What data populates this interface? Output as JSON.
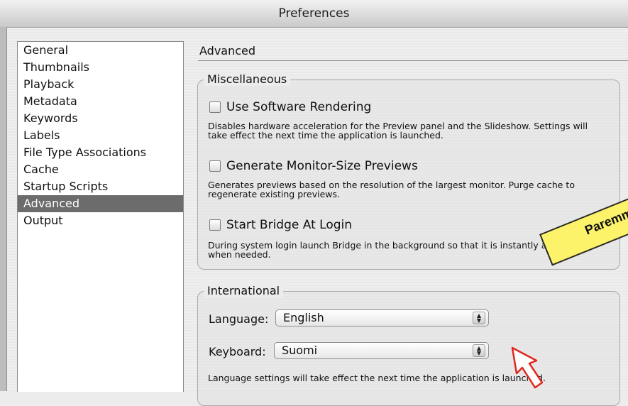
{
  "window": {
    "title": "Preferences"
  },
  "sidebar": {
    "items": [
      {
        "label": "General"
      },
      {
        "label": "Thumbnails"
      },
      {
        "label": "Playback"
      },
      {
        "label": "Metadata"
      },
      {
        "label": "Keywords"
      },
      {
        "label": "Labels"
      },
      {
        "label": "File Type Associations"
      },
      {
        "label": "Cache"
      },
      {
        "label": "Startup Scripts"
      },
      {
        "label": "Advanced",
        "selected": true
      },
      {
        "label": "Output"
      }
    ]
  },
  "panel": {
    "title": "Advanced",
    "misc": {
      "legend": "Miscellaneous",
      "software_rendering": {
        "label": "Use Software Rendering",
        "checked": false,
        "desc": "Disables hardware acceleration for the Preview panel and the Slideshow. Settings will take effect the next time the application is launched."
      },
      "monitor_previews": {
        "label": "Generate Monitor-Size Previews",
        "checked": false,
        "desc": "Generates previews based on the resolution of the largest monitor.  Purge cache to regenerate existing previews."
      },
      "start_at_login": {
        "label": "Start Bridge At Login",
        "checked": false,
        "desc": "During system login launch Bridge in the background so that it is instantly available when needed."
      }
    },
    "international": {
      "legend": "International",
      "language_label": "Language:",
      "language_value": "English",
      "keyboard_label": "Keyboard:",
      "keyboard_value": "Suomi",
      "note": "Language settings will take effect the next time the application is launched."
    }
  },
  "annotation": {
    "sticker_text": "Paremm",
    "sticker_color": "#fdf36b",
    "arrow_color": "#e0281e"
  }
}
